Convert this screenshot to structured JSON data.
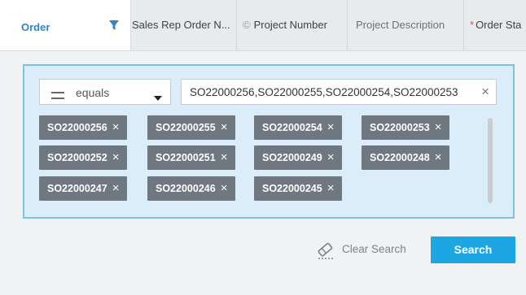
{
  "header": {
    "columns": [
      {
        "label": "Order",
        "active": true
      },
      {
        "label": "Sales Rep Order N..."
      },
      {
        "label": "Project Number"
      },
      {
        "label": "Project Description"
      },
      {
        "label": "Order Sta"
      }
    ]
  },
  "filter": {
    "operator": "equals",
    "value": "SO22000256,SO22000255,SO22000254,SO22000253",
    "clear_symbol": "×",
    "chips": [
      "SO22000256",
      "SO22000255",
      "SO22000254",
      "SO22000253",
      "SO22000252",
      "SO22000251",
      "SO22000249",
      "SO22000248",
      "SO22000247",
      "SO22000246",
      "SO22000245"
    ],
    "remove_symbol": "×"
  },
  "actions": {
    "clear_search": "Clear Search",
    "search": "Search"
  },
  "colors": {
    "accent": "#1ca6e4",
    "chip": "#6f7880",
    "panel": "#daedf8",
    "panel_border": "#7cc2e6",
    "required": "#e0574c"
  },
  "icons": [
    "filter-icon",
    "equals-icon",
    "caret-down-icon",
    "eraser-icon",
    "close-icon"
  ]
}
